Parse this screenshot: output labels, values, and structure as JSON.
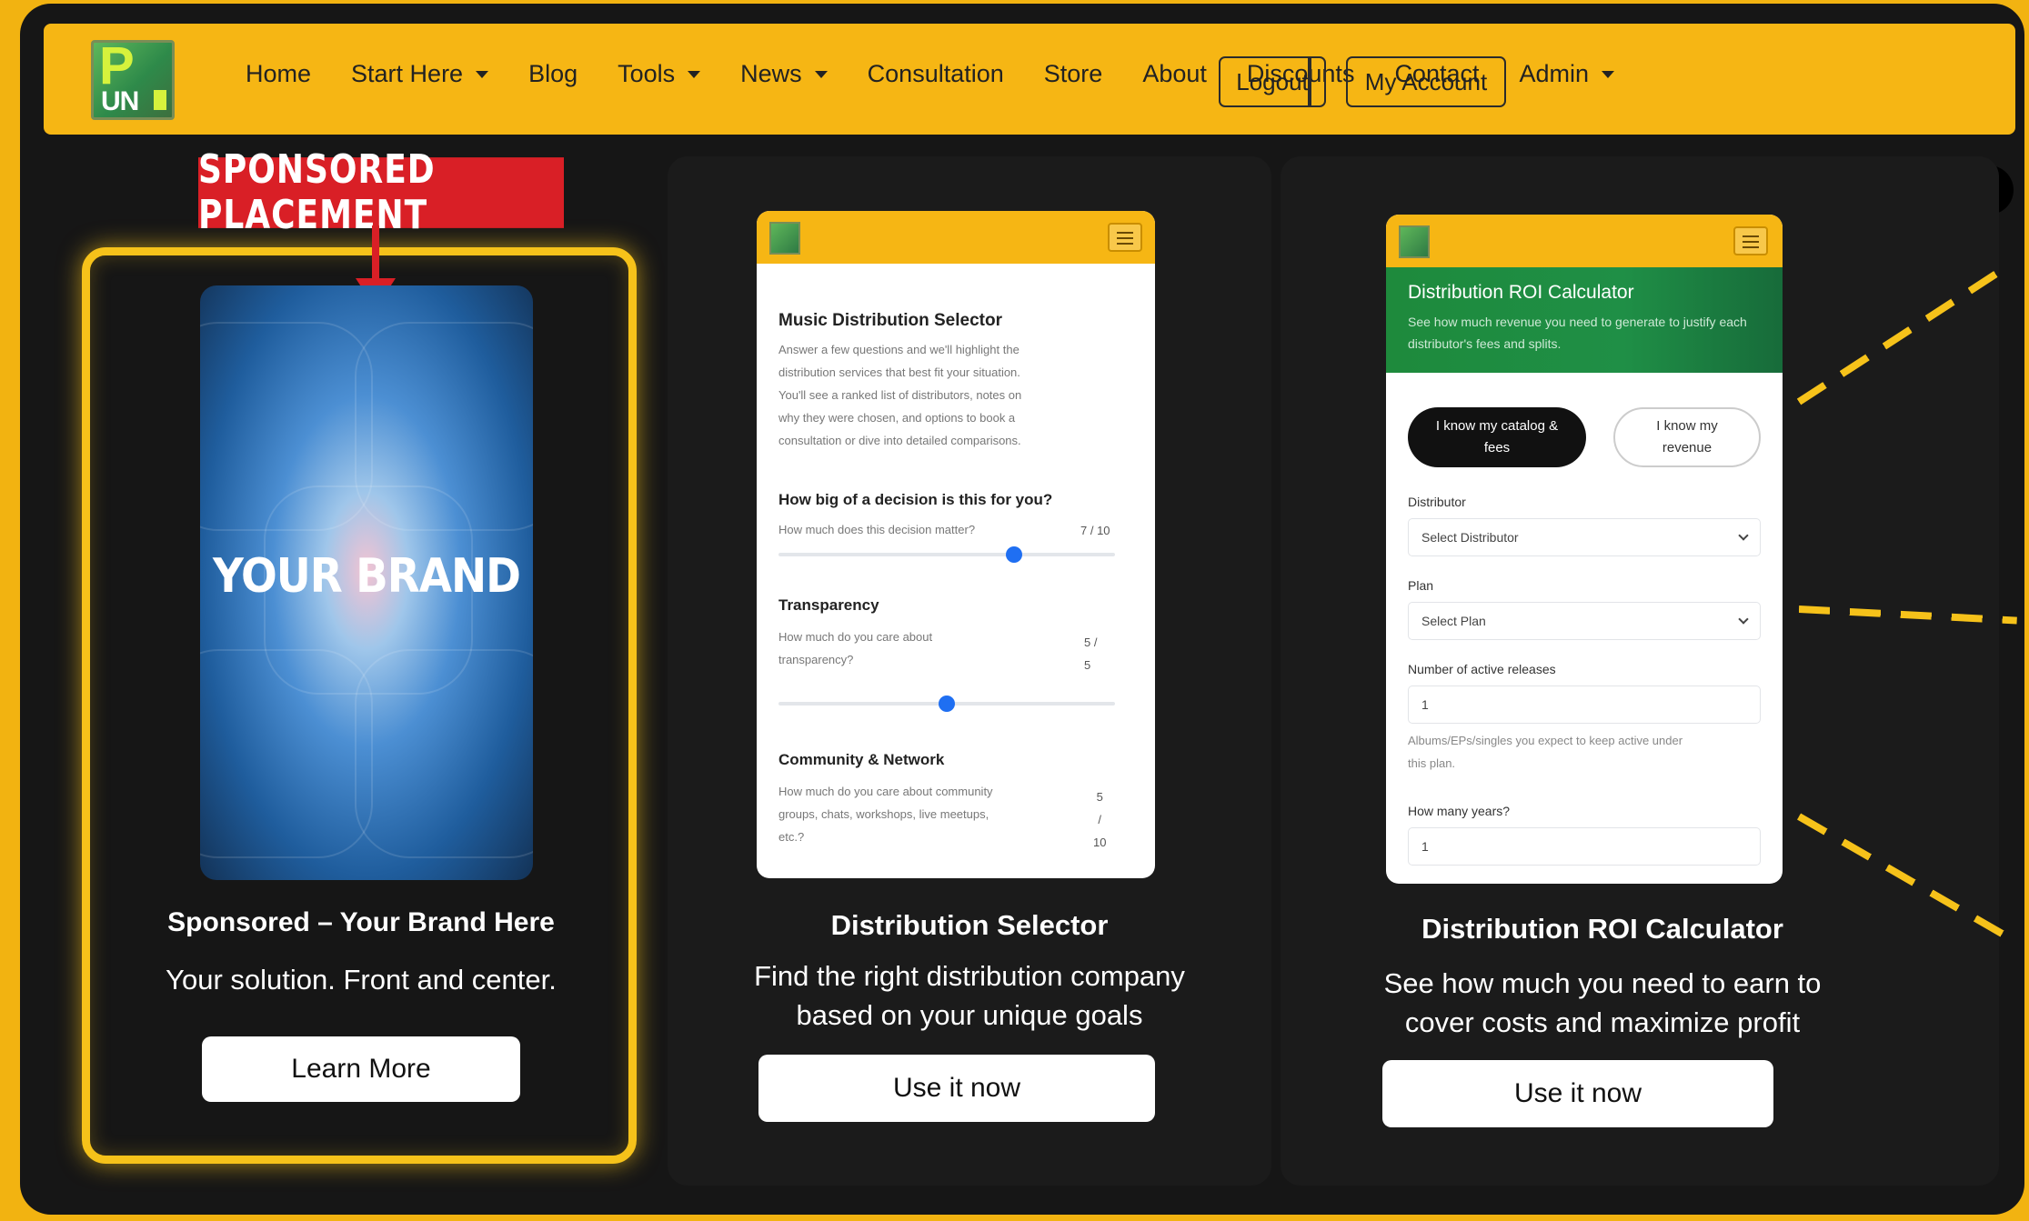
{
  "nav": {
    "logo_p": "P",
    "logo_un": "UN",
    "items": [
      {
        "label": "Home",
        "dropdown": false
      },
      {
        "label": "Start Here",
        "dropdown": true
      },
      {
        "label": "Blog",
        "dropdown": false
      },
      {
        "label": "Tools",
        "dropdown": true
      },
      {
        "label": "News",
        "dropdown": true
      },
      {
        "label": "Consultation",
        "dropdown": false
      },
      {
        "label": "Store",
        "dropdown": false
      },
      {
        "label": "About",
        "dropdown": false
      },
      {
        "label": "Discounts",
        "dropdown": false
      },
      {
        "label": "Contact",
        "dropdown": false
      },
      {
        "label": "Admin",
        "dropdown": true
      }
    ],
    "logout": "Logout",
    "account": "My Account"
  },
  "close_glyph": "×",
  "sponsored": {
    "tag": "SPONSORED PLACEMENT",
    "brand": "YOUR BRAND",
    "title": "Sponsored – Your Brand Here",
    "desc": "Your solution. Front and center.",
    "button": "Learn More"
  },
  "selector_card": {
    "title": "Distribution Selector",
    "desc_line1": "Find the right distribution company",
    "desc_line2": "based on your unique goals",
    "button": "Use it now",
    "phone": {
      "heading": "Music Distribution Selector",
      "intro": [
        "Answer a few questions and we'll highlight the",
        "distribution services that best fit your situation.",
        "You'll see a ranked list of distributors, notes on",
        "why they were chosen, and options to book a",
        "consultation or dive into detailed comparisons."
      ],
      "q1_title": "How big of a decision is this for you?",
      "q1_text": "How much does this decision matter?",
      "q1_val": "7 / 10",
      "q1_level": 0.7,
      "q2_title": "Transparency",
      "q2_text": [
        "How much do you care about",
        "transparency?"
      ],
      "q2_val": [
        "5 /",
        "5"
      ],
      "q2_level": 0.5,
      "q3_title": "Community & Network",
      "q3_text": [
        "How much do you care about community",
        "groups, chats, workshops, live meetups,",
        "etc.?"
      ],
      "q3_val": [
        "5",
        "/",
        "10"
      ]
    }
  },
  "roi_card": {
    "title": "Distribution ROI Calculator",
    "desc_line1": "See how much you need to earn to",
    "desc_line2": "cover costs and maximize profit",
    "button": "Use it now",
    "phone": {
      "heading": "Distribution ROI Calculator",
      "sub": "See how much revenue you need to generate to justify each distributor's fees and splits.",
      "pill_active": [
        "I know my catalog &",
        "fees"
      ],
      "pill_other": [
        "I know my",
        "revenue"
      ],
      "distributor_label": "Distributor",
      "distributor_value": "Select Distributor",
      "plan_label": "Plan",
      "plan_value": "Select Plan",
      "releases_label": "Number of active releases",
      "releases_value": "1",
      "releases_help": [
        "Albums/EPs/singles you expect to keep active under",
        "this plan."
      ],
      "years_label": "How many years?",
      "years_value": "1"
    }
  },
  "colors": {
    "brand_yellow": "#f6b614",
    "sponsor_red": "#d91f26",
    "roi_green": "#1e8a3c",
    "slider_blue": "#1f6ff2"
  }
}
